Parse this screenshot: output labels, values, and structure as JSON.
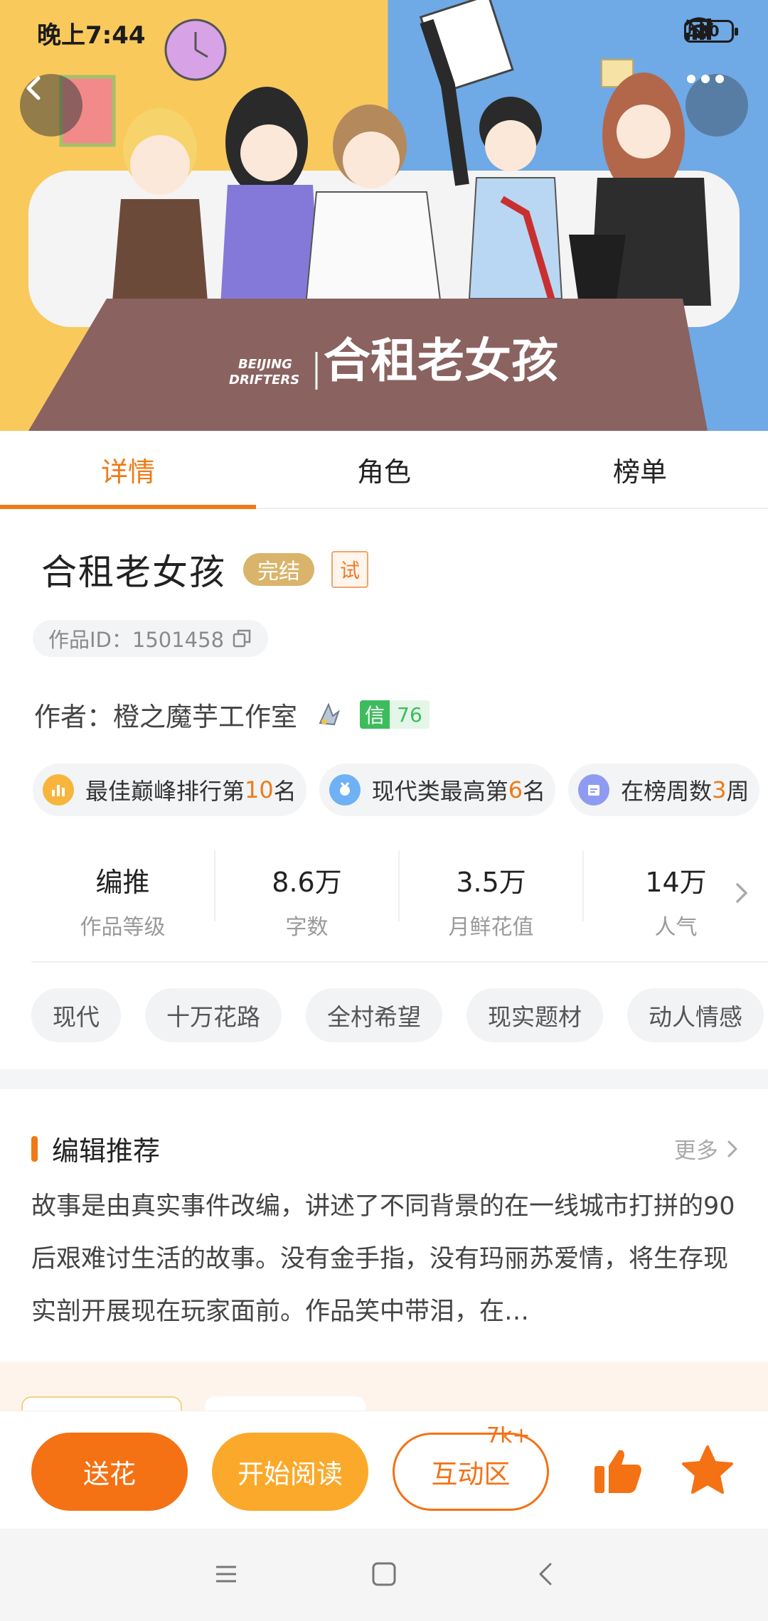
{
  "status": {
    "time": "晚上7:44",
    "battery": "50"
  },
  "cover": {
    "title_art": "合租老女孩",
    "logo_en_1": "BEIJING",
    "logo_en_2": "DRIFTERS"
  },
  "tabs": [
    {
      "label": "详情",
      "active": true
    },
    {
      "label": "角色",
      "active": false
    },
    {
      "label": "榜单",
      "active": false
    }
  ],
  "book": {
    "title": "合租老女孩",
    "status_badge": "完结",
    "trial_badge": "试",
    "id_label": "作品ID：1501458",
    "author": "作者：橙之魔芋工作室",
    "credit_label": "信",
    "credit_value": "76"
  },
  "ranks": [
    {
      "prefix": "最佳巅峰排行第",
      "num": "10",
      "suffix": "名",
      "icon": "bar-chart-icon",
      "color": "#f7b53c"
    },
    {
      "prefix": "现代类最高第",
      "num": "6",
      "suffix": "名",
      "icon": "medal-icon",
      "color": "#6fb1f5"
    },
    {
      "prefix": "在榜周数",
      "num": "3",
      "suffix": "周",
      "icon": "calendar-icon",
      "color": "#8f9bf2"
    }
  ],
  "stats": [
    {
      "value": "编推",
      "label": "作品等级"
    },
    {
      "value": "8.6万",
      "label": "字数"
    },
    {
      "value": "3.5万",
      "label": "月鲜花值"
    },
    {
      "value": "14万",
      "label": "人气"
    }
  ],
  "tags": [
    "现代",
    "十万花路",
    "全村希望",
    "现实题材",
    "动人情感"
  ],
  "recommend": {
    "title": "编辑推荐",
    "more": "更多",
    "body": "故事是由真实事件改编，讲述了不同背景的在一线城市打拼的90后艰难讨生活的故事。没有金手指，没有玛丽苏爱情，将生存现实剖开展现在玩家面前。作品笑中带泪，在…"
  },
  "actions": {
    "flower": "送花",
    "read": "开始阅读",
    "zone": "互动区",
    "zone_count": "7k+"
  },
  "colors": {
    "accent": "#ef7a16",
    "read": "#fba92b",
    "credit": "#3dbc5d"
  }
}
